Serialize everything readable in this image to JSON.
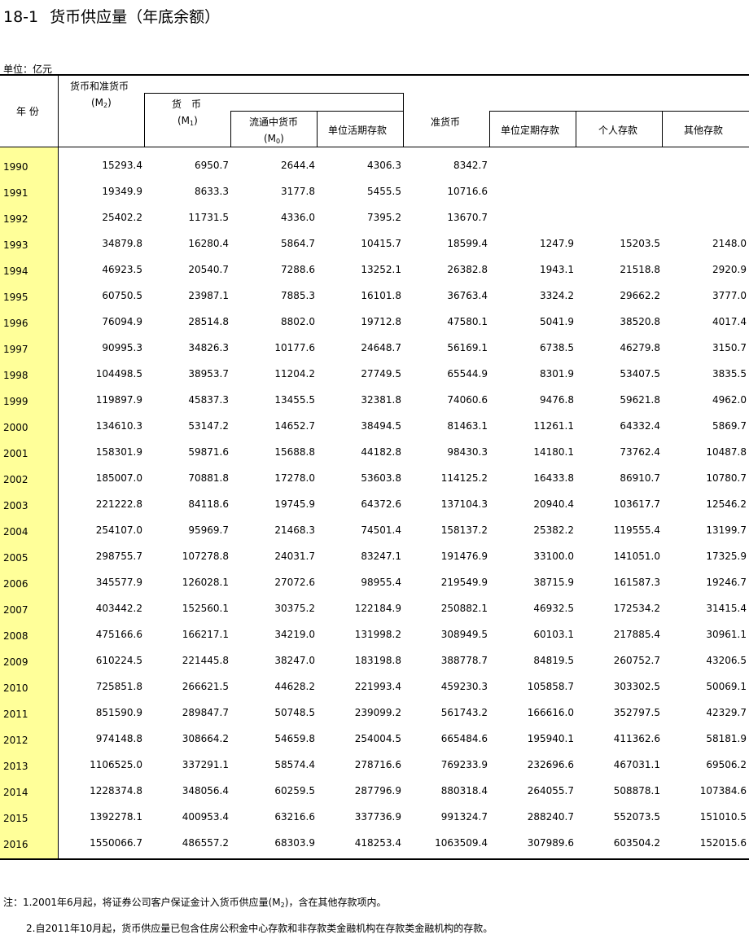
{
  "title": {
    "number": "18-1",
    "text": "货币供应量（年底余额）"
  },
  "unit_label": "单位：亿元",
  "headers": {
    "year": "年 份",
    "m2_label": "货币和准货币",
    "m2_code": "(M",
    "m2_sub": "2",
    "m2_close": ")",
    "m1_label": "货　币",
    "m1_code": "(M",
    "m1_sub": "1",
    "m1_close": ")",
    "m0_label": "流通中货币",
    "m0_code": "(M",
    "m0_sub": "0",
    "m0_close": ")",
    "demand": "单位活期存款",
    "quasi": "准货币",
    "time_dep": "单位定期存款",
    "personal": "个人存款",
    "other": "其他存款"
  },
  "rows": [
    [
      "1990",
      "15293.4",
      "6950.7",
      "2644.4",
      "4306.3",
      "8342.7",
      "",
      "",
      ""
    ],
    [
      "1991",
      "19349.9",
      "8633.3",
      "3177.8",
      "5455.5",
      "10716.6",
      "",
      "",
      ""
    ],
    [
      "1992",
      "25402.2",
      "11731.5",
      "4336.0",
      "7395.2",
      "13670.7",
      "",
      "",
      ""
    ],
    [
      "1993",
      "34879.8",
      "16280.4",
      "5864.7",
      "10415.7",
      "18599.4",
      "1247.9",
      "15203.5",
      "2148.0"
    ],
    [
      "1994",
      "46923.5",
      "20540.7",
      "7288.6",
      "13252.1",
      "26382.8",
      "1943.1",
      "21518.8",
      "2920.9"
    ],
    [
      "1995",
      "60750.5",
      "23987.1",
      "7885.3",
      "16101.8",
      "36763.4",
      "3324.2",
      "29662.2",
      "3777.0"
    ],
    [
      "1996",
      "76094.9",
      "28514.8",
      "8802.0",
      "19712.8",
      "47580.1",
      "5041.9",
      "38520.8",
      "4017.4"
    ],
    [
      "1997",
      "90995.3",
      "34826.3",
      "10177.6",
      "24648.7",
      "56169.1",
      "6738.5",
      "46279.8",
      "3150.7"
    ],
    [
      "1998",
      "104498.5",
      "38953.7",
      "11204.2",
      "27749.5",
      "65544.9",
      "8301.9",
      "53407.5",
      "3835.5"
    ],
    [
      "1999",
      "119897.9",
      "45837.3",
      "13455.5",
      "32381.8",
      "74060.6",
      "9476.8",
      "59621.8",
      "4962.0"
    ],
    [
      "2000",
      "134610.3",
      "53147.2",
      "14652.7",
      "38494.5",
      "81463.1",
      "11261.1",
      "64332.4",
      "5869.7"
    ],
    [
      "2001",
      "158301.9",
      "59871.6",
      "15688.8",
      "44182.8",
      "98430.3",
      "14180.1",
      "73762.4",
      "10487.8"
    ],
    [
      "2002",
      "185007.0",
      "70881.8",
      "17278.0",
      "53603.8",
      "114125.2",
      "16433.8",
      "86910.7",
      "10780.7"
    ],
    [
      "2003",
      "221222.8",
      "84118.6",
      "19745.9",
      "64372.6",
      "137104.3",
      "20940.4",
      "103617.7",
      "12546.2"
    ],
    [
      "2004",
      "254107.0",
      "95969.7",
      "21468.3",
      "74501.4",
      "158137.2",
      "25382.2",
      "119555.4",
      "13199.7"
    ],
    [
      "2005",
      "298755.7",
      "107278.8",
      "24031.7",
      "83247.1",
      "191476.9",
      "33100.0",
      "141051.0",
      "17325.9"
    ],
    [
      "2006",
      "345577.9",
      "126028.1",
      "27072.6",
      "98955.4",
      "219549.9",
      "38715.9",
      "161587.3",
      "19246.7"
    ],
    [
      "2007",
      "403442.2",
      "152560.1",
      "30375.2",
      "122184.9",
      "250882.1",
      "46932.5",
      "172534.2",
      "31415.4"
    ],
    [
      "2008",
      "475166.6",
      "166217.1",
      "34219.0",
      "131998.2",
      "308949.5",
      "60103.1",
      "217885.4",
      "30961.1"
    ],
    [
      "2009",
      "610224.5",
      "221445.8",
      "38247.0",
      "183198.8",
      "388778.7",
      "84819.5",
      "260752.7",
      "43206.5"
    ],
    [
      "2010",
      "725851.8",
      "266621.5",
      "44628.2",
      "221993.4",
      "459230.3",
      "105858.7",
      "303302.5",
      "50069.1"
    ],
    [
      "2011",
      "851590.9",
      "289847.7",
      "50748.5",
      "239099.2",
      "561743.2",
      "166616.0",
      "352797.5",
      "42329.7"
    ],
    [
      "2012",
      "974148.8",
      "308664.2",
      "54659.8",
      "254004.5",
      "665484.6",
      "195940.1",
      "411362.6",
      "58181.9"
    ],
    [
      "2013",
      "1106525.0",
      "337291.1",
      "58574.4",
      "278716.6",
      "769233.9",
      "232696.6",
      "467031.1",
      "69506.2"
    ],
    [
      "2014",
      "1228374.8",
      "348056.4",
      "60259.5",
      "287796.9",
      "880318.4",
      "264055.7",
      "508878.1",
      "107384.6"
    ],
    [
      "2015",
      "1392278.1",
      "400953.4",
      "63216.6",
      "337736.9",
      "991324.7",
      "288240.7",
      "552073.5",
      "151010.5"
    ],
    [
      "2016",
      "1550066.7",
      "486557.2",
      "68303.9",
      "418253.4",
      "1063509.4",
      "307989.6",
      "603504.2",
      "152015.6"
    ]
  ],
  "notes": [
    {
      "before": "注：1.2001年6月起，将证券公司客户保证金计入货币供应量(M",
      "sub": "2",
      "after": ")，含在其他存款项内。"
    },
    {
      "before": "2.自2011年10月起，货币供应量已包含住房公积金中心存款和非存款类金融机构在存款类金融机构的存款。",
      "sub": "",
      "after": ""
    }
  ]
}
